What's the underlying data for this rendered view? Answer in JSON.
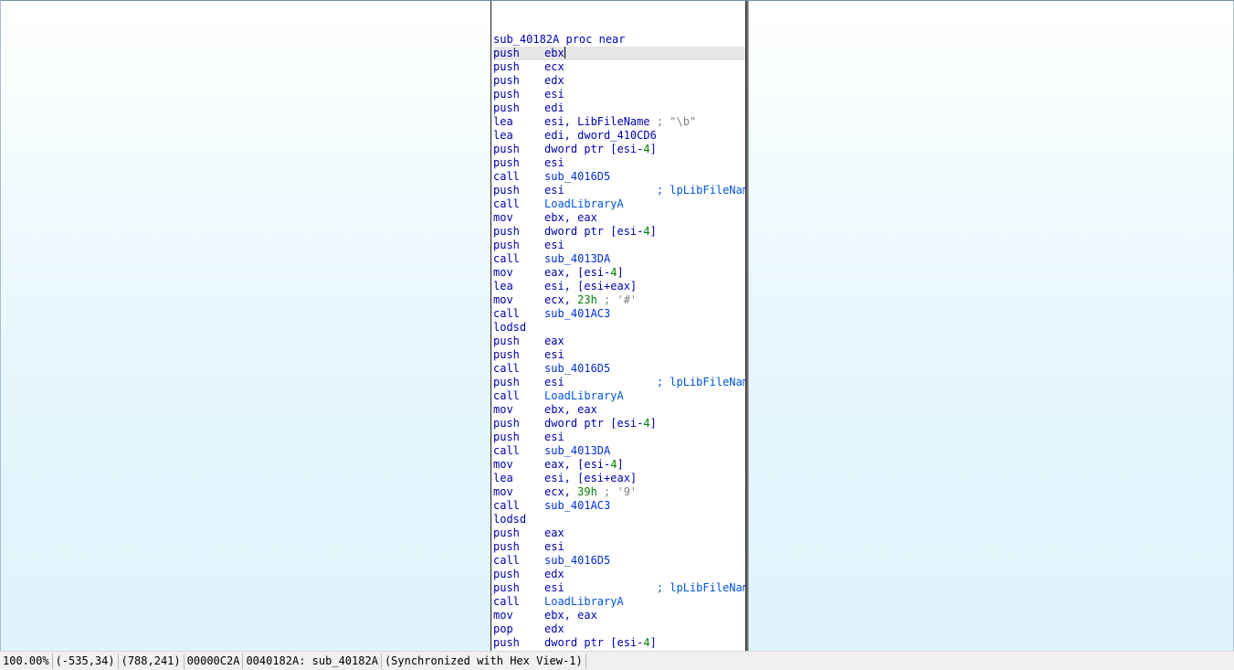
{
  "graph": {
    "proc_header": "sub_40182A proc near",
    "lines": [
      {
        "mn": "push",
        "ops": [
          {
            "t": "reg",
            "v": "ebx"
          }
        ],
        "highlight": true
      },
      {
        "mn": "push",
        "ops": [
          {
            "t": "reg",
            "v": "ecx"
          }
        ]
      },
      {
        "mn": "push",
        "ops": [
          {
            "t": "reg",
            "v": "edx"
          }
        ]
      },
      {
        "mn": "push",
        "ops": [
          {
            "t": "reg",
            "v": "esi"
          }
        ]
      },
      {
        "mn": "push",
        "ops": [
          {
            "t": "reg",
            "v": "edi"
          }
        ]
      },
      {
        "mn": "lea",
        "ops": [
          {
            "t": "reg",
            "v": "esi, LibFileName"
          },
          {
            "t": "cmt",
            "v": " ; \"\\b\""
          }
        ]
      },
      {
        "mn": "lea",
        "ops": [
          {
            "t": "reg",
            "v": "edi, dword_410CD6"
          }
        ]
      },
      {
        "mn": "push",
        "ops": [
          {
            "t": "reg",
            "v": "dword ptr [esi-"
          },
          {
            "t": "num",
            "v": "4"
          },
          {
            "t": "reg",
            "v": "]"
          }
        ]
      },
      {
        "mn": "push",
        "ops": [
          {
            "t": "reg",
            "v": "esi"
          }
        ]
      },
      {
        "mn": "call",
        "ops": [
          {
            "t": "sym",
            "v": "sub_4016D5"
          }
        ]
      },
      {
        "mn": "push",
        "ops": [
          {
            "t": "reg",
            "v": "esi"
          },
          {
            "t": "imp",
            "v": "              ; lpLibFileName"
          }
        ]
      },
      {
        "mn": "call",
        "ops": [
          {
            "t": "imp",
            "v": "LoadLibraryA"
          }
        ]
      },
      {
        "mn": "mov",
        "ops": [
          {
            "t": "reg",
            "v": "ebx, eax"
          }
        ]
      },
      {
        "mn": "push",
        "ops": [
          {
            "t": "reg",
            "v": "dword ptr [esi-"
          },
          {
            "t": "num",
            "v": "4"
          },
          {
            "t": "reg",
            "v": "]"
          }
        ]
      },
      {
        "mn": "push",
        "ops": [
          {
            "t": "reg",
            "v": "esi"
          }
        ]
      },
      {
        "mn": "call",
        "ops": [
          {
            "t": "sym",
            "v": "sub_4013DA"
          }
        ]
      },
      {
        "mn": "mov",
        "ops": [
          {
            "t": "reg",
            "v": "eax, [esi-"
          },
          {
            "t": "num",
            "v": "4"
          },
          {
            "t": "reg",
            "v": "]"
          }
        ]
      },
      {
        "mn": "lea",
        "ops": [
          {
            "t": "reg",
            "v": "esi, [esi+eax]"
          }
        ]
      },
      {
        "mn": "mov",
        "ops": [
          {
            "t": "reg",
            "v": "ecx, "
          },
          {
            "t": "num",
            "v": "23h"
          },
          {
            "t": "cmt",
            "v": " ; '#'"
          }
        ]
      },
      {
        "mn": "call",
        "ops": [
          {
            "t": "sym",
            "v": "sub_401AC3"
          }
        ]
      },
      {
        "mn": "lodsd",
        "ops": []
      },
      {
        "mn": "push",
        "ops": [
          {
            "t": "reg",
            "v": "eax"
          }
        ]
      },
      {
        "mn": "push",
        "ops": [
          {
            "t": "reg",
            "v": "esi"
          }
        ]
      },
      {
        "mn": "call",
        "ops": [
          {
            "t": "sym",
            "v": "sub_4016D5"
          }
        ]
      },
      {
        "mn": "push",
        "ops": [
          {
            "t": "reg",
            "v": "esi"
          },
          {
            "t": "imp",
            "v": "              ; lpLibFileName"
          }
        ]
      },
      {
        "mn": "call",
        "ops": [
          {
            "t": "imp",
            "v": "LoadLibraryA"
          }
        ]
      },
      {
        "mn": "mov",
        "ops": [
          {
            "t": "reg",
            "v": "ebx, eax"
          }
        ]
      },
      {
        "mn": "push",
        "ops": [
          {
            "t": "reg",
            "v": "dword ptr [esi-"
          },
          {
            "t": "num",
            "v": "4"
          },
          {
            "t": "reg",
            "v": "]"
          }
        ]
      },
      {
        "mn": "push",
        "ops": [
          {
            "t": "reg",
            "v": "esi"
          }
        ]
      },
      {
        "mn": "call",
        "ops": [
          {
            "t": "sym",
            "v": "sub_4013DA"
          }
        ]
      },
      {
        "mn": "mov",
        "ops": [
          {
            "t": "reg",
            "v": "eax, [esi-"
          },
          {
            "t": "num",
            "v": "4"
          },
          {
            "t": "reg",
            "v": "]"
          }
        ]
      },
      {
        "mn": "lea",
        "ops": [
          {
            "t": "reg",
            "v": "esi, [esi+eax]"
          }
        ]
      },
      {
        "mn": "mov",
        "ops": [
          {
            "t": "reg",
            "v": "ecx, "
          },
          {
            "t": "num",
            "v": "39h"
          },
          {
            "t": "cmt",
            "v": " ; '9'"
          }
        ]
      },
      {
        "mn": "call",
        "ops": [
          {
            "t": "sym",
            "v": "sub_401AC3"
          }
        ]
      },
      {
        "mn": "lodsd",
        "ops": []
      },
      {
        "mn": "push",
        "ops": [
          {
            "t": "reg",
            "v": "eax"
          }
        ]
      },
      {
        "mn": "push",
        "ops": [
          {
            "t": "reg",
            "v": "esi"
          }
        ]
      },
      {
        "mn": "call",
        "ops": [
          {
            "t": "sym",
            "v": "sub_4016D5"
          }
        ]
      },
      {
        "mn": "push",
        "ops": [
          {
            "t": "reg",
            "v": "edx"
          }
        ]
      },
      {
        "mn": "push",
        "ops": [
          {
            "t": "reg",
            "v": "esi"
          },
          {
            "t": "imp",
            "v": "              ; lpLibFileName"
          }
        ]
      },
      {
        "mn": "call",
        "ops": [
          {
            "t": "imp",
            "v": "LoadLibraryA"
          }
        ]
      },
      {
        "mn": "mov",
        "ops": [
          {
            "t": "reg",
            "v": "ebx, eax"
          }
        ]
      },
      {
        "mn": "pop",
        "ops": [
          {
            "t": "reg",
            "v": "edx"
          }
        ]
      },
      {
        "mn": "push",
        "ops": [
          {
            "t": "reg",
            "v": "dword ptr [esi-"
          },
          {
            "t": "num",
            "v": "4"
          },
          {
            "t": "reg",
            "v": "]"
          }
        ]
      }
    ]
  },
  "statusbar": {
    "zoom": "100.00%",
    "mouse_coords": "(-535,34)",
    "graph_coords": "(788,241)",
    "file_offset": "00000C2A",
    "address_label": "0040182A: sub_40182A",
    "sync_status": "(Synchronized with Hex View-1)"
  },
  "colors": {
    "code_text": "#0000b0",
    "number": "#007f00",
    "comment": "#808080",
    "highlight": "#e6e6e6"
  }
}
